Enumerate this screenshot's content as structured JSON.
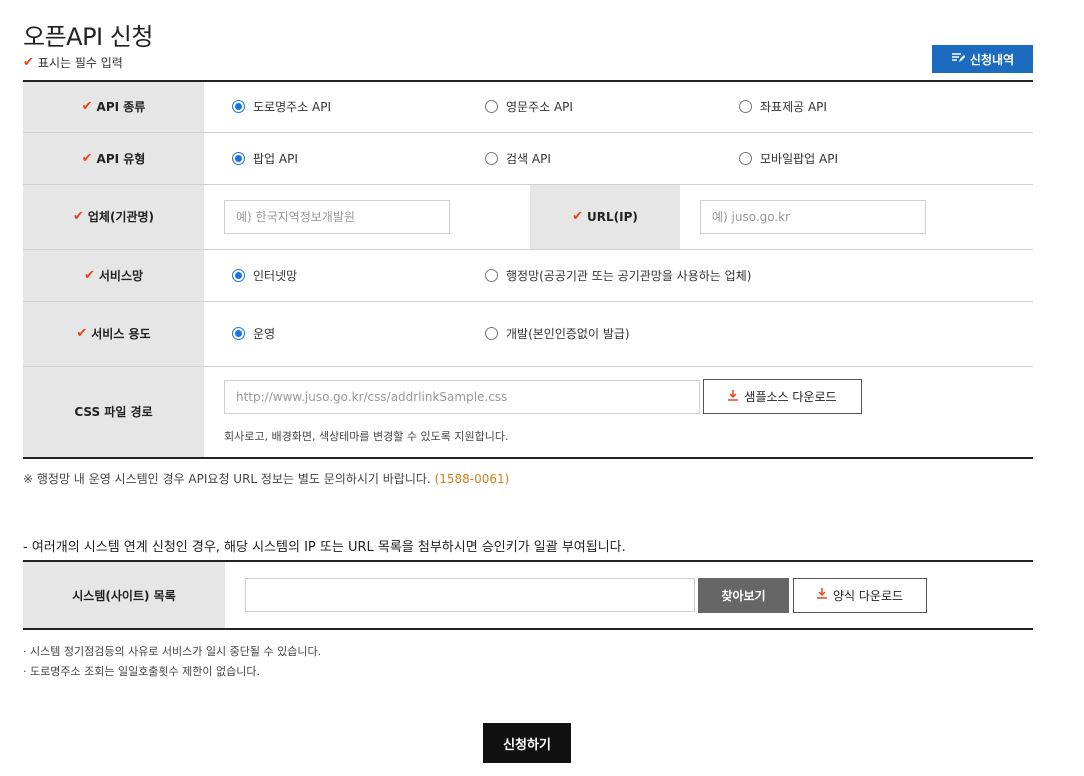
{
  "page": {
    "title": "오픈API 신청",
    "required_note": "표시는 필수 입력",
    "history_button": "신청내역",
    "check_mark": "✔"
  },
  "form": {
    "api_type": {
      "label": "API 종류",
      "options": [
        "도로명주소 API",
        "영문주소 API",
        "좌표제공 API"
      ],
      "selected": "도로명주소 API"
    },
    "api_kind": {
      "label": "API 유형",
      "options": [
        "팝업 API",
        "검색 API",
        "모바일팝업 API"
      ],
      "selected": "팝업 API"
    },
    "company": {
      "label": "업체(기관명)",
      "placeholder": "예) 한국지역정보개발원"
    },
    "url": {
      "label": "URL(IP)",
      "placeholder": "예) juso.go.kr"
    },
    "network": {
      "label": "서비스망",
      "options": [
        "인터넷망",
        "행정망(공공기관 또는 공기관망을 사용하는 업체)"
      ],
      "selected": "인터넷망"
    },
    "usage": {
      "label": "서비스 용도",
      "options": [
        "운영",
        "개발(본인인증없이 발급)"
      ],
      "selected": "운영"
    },
    "css_path": {
      "label": "CSS 파일 경로",
      "placeholder": "http://www.juso.go.kr/css/addrlinkSample.css",
      "download_button": "샘플소스 다운로드",
      "help": "회사로고, 배경화면, 색상테마를 변경할 수 있도록 지원합니다."
    }
  },
  "notice": {
    "text": "※ 행정망 내 운영 시스템인 경우 API요청 URL 정보는 별도 문의하시기 바랍니다.",
    "phone": "(1588-0061)"
  },
  "multi_system": {
    "note": "- 여러개의 시스템 연계 신청인 경우, 해당 시스템의 IP 또는 URL 목록을 첨부하시면 승인키가 일괄 부여됩니다.",
    "label": "시스템(사이트) 목록",
    "file_value": "",
    "browse_button": "찾아보기",
    "form_download_button": "양식 다운로드"
  },
  "bullets": [
    "시스템 정기점검등의 사유로 서비스가 일시 중단될 수 있습니다.",
    "도로명주소 조회는 일일호출횟수 제한이 없습니다."
  ],
  "submit_button": "신청하기",
  "colors": {
    "accent_blue": "#1b6bbf",
    "check_red": "#e8431c",
    "phone_orange": "#d08020",
    "radio_blue": "#1a73e8"
  }
}
